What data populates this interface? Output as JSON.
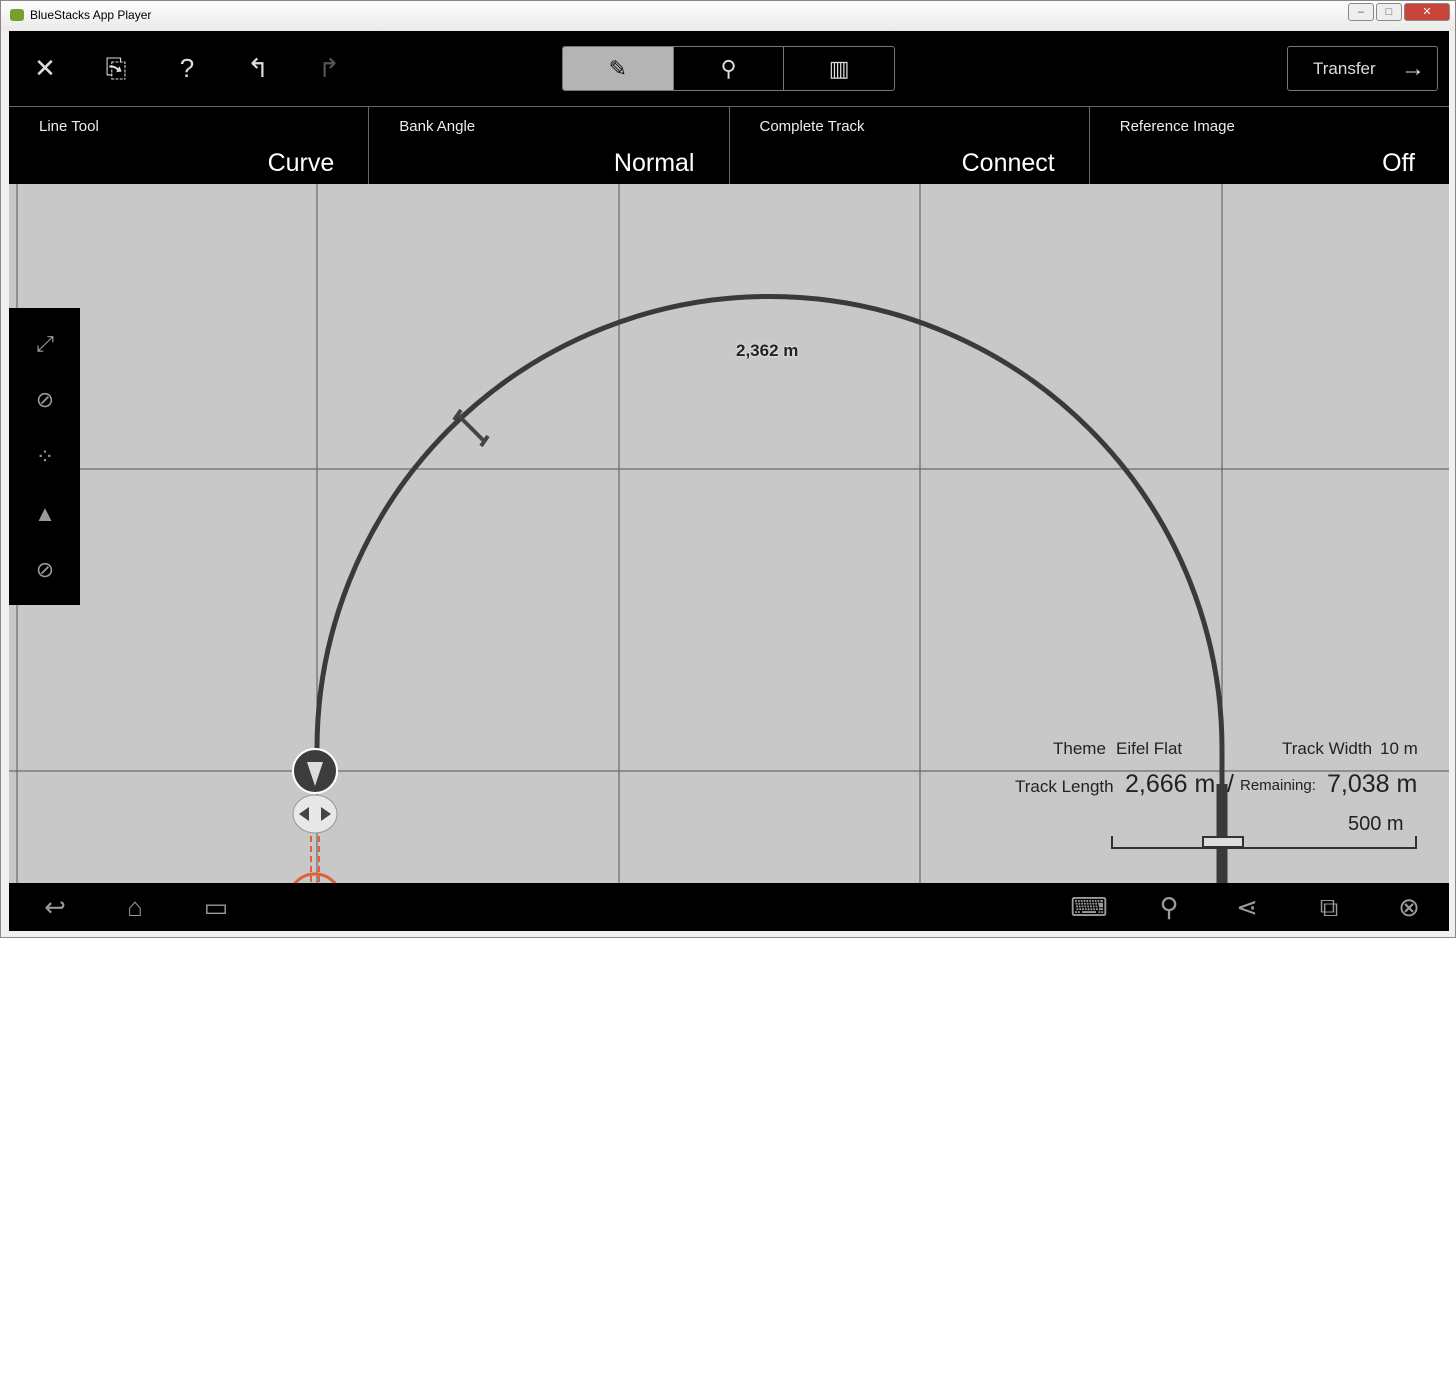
{
  "window": {
    "title": "BlueStacks App Player"
  },
  "toolbar": {
    "transfer_label": "Transfer",
    "modes": [
      "edit",
      "marker",
      "columns"
    ],
    "active_mode": "edit"
  },
  "settings": [
    {
      "label": "Line Tool",
      "value": "Curve"
    },
    {
      "label": "Bank Angle",
      "value": "Normal"
    },
    {
      "label": "Complete Track",
      "value": "Connect"
    },
    {
      "label": "Reference Image",
      "value": "Off"
    }
  ],
  "map": {
    "segment_label": "2,362 m",
    "theme_label": "Theme",
    "theme_value": "Eifel Flat",
    "width_label": "Track Width",
    "width_value": "10 m",
    "length_label": "Track Length",
    "length_value": "2,666 m",
    "separator": "/",
    "remaining_label": "Remaining:",
    "remaining_value": "7,038 m",
    "scale_label": "500 m",
    "track_color": "#3a3a3a",
    "accent_color": "#e0603a"
  }
}
